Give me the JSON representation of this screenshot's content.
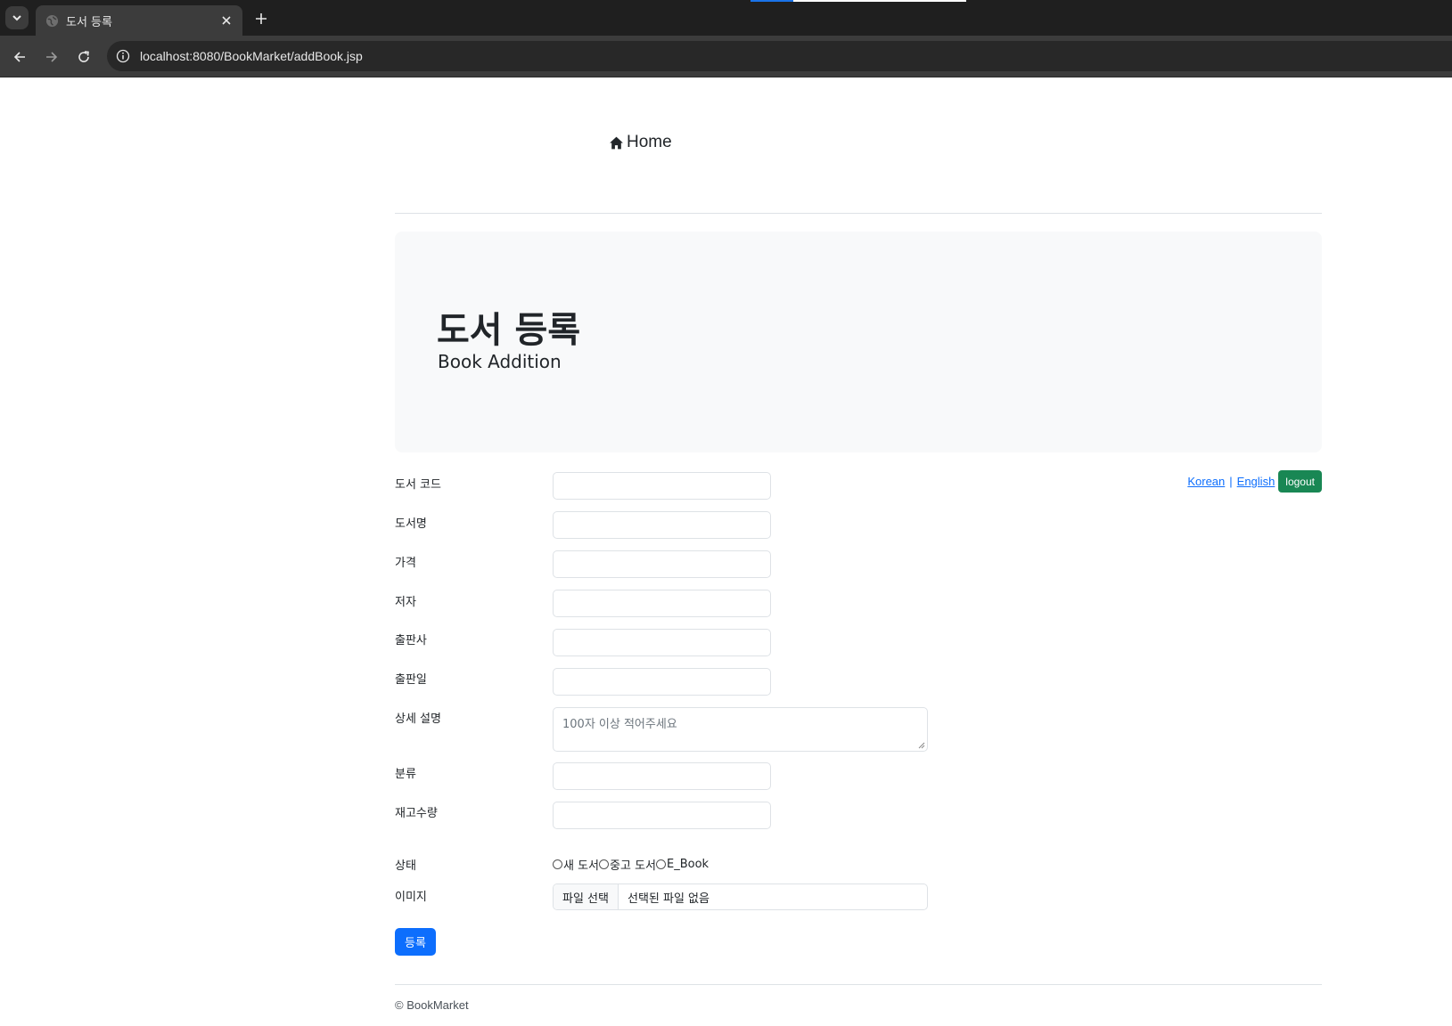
{
  "browser": {
    "tab_title": "도서 등록",
    "url": "localhost:8080/BookMarket/addBook.jsp"
  },
  "nav": {
    "home_label": "Home"
  },
  "jumbotron": {
    "title": "도서 등록",
    "subtitle": "Book Addition"
  },
  "lang": {
    "korean": "Korean",
    "separator": "|",
    "english": "English",
    "logout": "logout"
  },
  "form": {
    "book_code_label": "도서 코드",
    "book_name_label": "도서명",
    "price_label": "가격",
    "author_label": "저자",
    "publisher_label": "출판사",
    "release_date_label": "출판일",
    "description_label": "상세 설명",
    "description_placeholder": "100자 이상 적어주세요",
    "category_label": "분류",
    "stock_label": "재고수량",
    "condition_label": "상태",
    "condition_options": [
      "새 도서",
      "중고 도서",
      "E_Book"
    ],
    "image_label": "이미지",
    "file_button": "파일 선택",
    "file_status": "선택된 파일 없음",
    "submit_label": "등록"
  },
  "footer": {
    "text": "© BookMarket"
  },
  "colors": {
    "primary": "#0d6efd",
    "success": "#198754",
    "jumbotron_bg": "#f8f9fa"
  }
}
